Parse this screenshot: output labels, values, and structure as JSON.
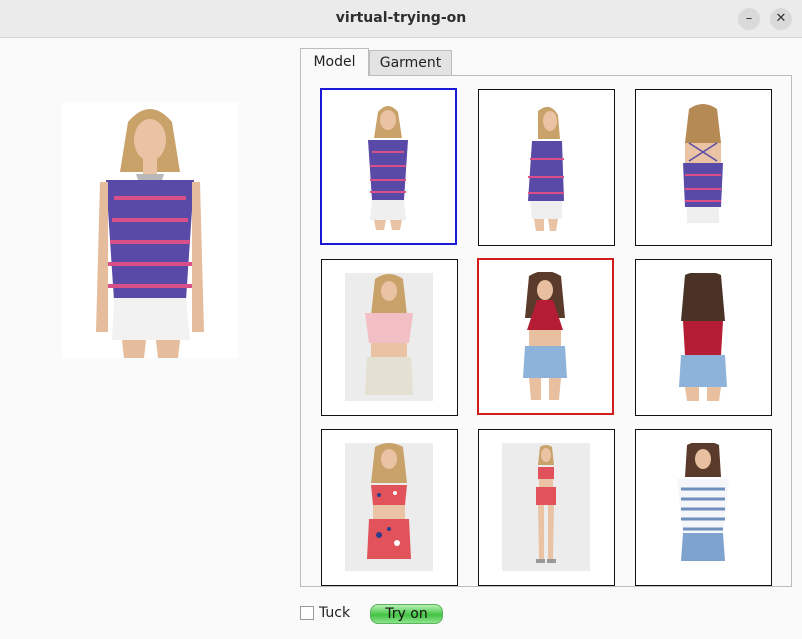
{
  "window": {
    "title": "virtual-trying-on",
    "minimize_glyph": "–",
    "close_glyph": "✕"
  },
  "tabs": [
    {
      "label": "Model",
      "active": true
    },
    {
      "label": "Garment",
      "active": false
    }
  ],
  "gallery": {
    "selected_model_index": 0,
    "selected_garment_index": 4,
    "items": [
      {
        "top": "purple patterned cami",
        "bottom": "white shorts",
        "view": "front"
      },
      {
        "top": "purple patterned cami",
        "bottom": "white shorts",
        "view": "side"
      },
      {
        "top": "purple patterned cami",
        "bottom": "white shorts",
        "view": "back"
      },
      {
        "top": "pink tee",
        "bottom": "light denim shorts",
        "view": "front"
      },
      {
        "top": "red halter top",
        "bottom": "blue denim shorts",
        "view": "front"
      },
      {
        "top": "red halter top",
        "bottom": "blue denim shorts",
        "view": "back"
      },
      {
        "top": "red floral bralette",
        "bottom": "floral shorts",
        "view": "front"
      },
      {
        "top": "red floral bralette",
        "bottom": "floral shorts",
        "view": "full-length"
      },
      {
        "top": "striped v-neck tee",
        "bottom": "chambray shorts",
        "view": "front"
      }
    ]
  },
  "controls": {
    "tuck_label": "Tuck",
    "tuck_checked": false,
    "try_on_label": "Try on"
  },
  "colors": {
    "model_selection": "#1a1ad6",
    "garment_selection": "#d11c1c",
    "try_on_button": "#43c443"
  }
}
